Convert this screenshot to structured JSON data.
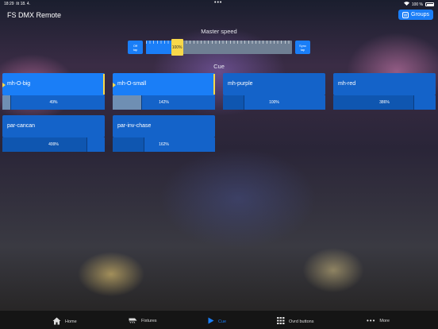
{
  "status": {
    "time": "18:29",
    "date": "št 18. 4.",
    "battery": "100 %"
  },
  "app": {
    "title": "FS DMX Remote",
    "groups_label": "Groups",
    "groups_icon": "groups-icon"
  },
  "master_speed": {
    "label": "Master speed",
    "off_label": "Off",
    "off_sub": "tap",
    "sync_label": "Sync",
    "sync_sub": "tap",
    "value": 100,
    "value_text": "100%",
    "position_fraction": 0.21
  },
  "cue_section": {
    "label": "Cue"
  },
  "cues": [
    {
      "name": "mh-O-big",
      "level_text": "49%",
      "level_fraction": 0.08,
      "playing": true
    },
    {
      "name": "mh-O-small",
      "level_text": "142%",
      "level_fraction": 0.28,
      "playing": true
    },
    {
      "name": "mh-purple",
      "level_text": "100%",
      "level_fraction": 0.2,
      "playing": false
    },
    {
      "name": "mh-red",
      "level_text": "386%",
      "level_fraction": 0.78,
      "playing": false
    },
    {
      "name": "par-cancan",
      "level_text": "499%",
      "level_fraction": 0.82,
      "playing": false
    },
    {
      "name": "par-inv-chase",
      "level_text": "162%",
      "level_fraction": 0.3,
      "playing": false
    }
  ],
  "colors": {
    "accent": "#1a7ef7",
    "cue_active": "#1a7ef7",
    "cue_idle": "#1463c9",
    "yellow": "#f8d84a"
  },
  "tabs": [
    {
      "label": "Home",
      "icon": "house-icon",
      "active": false
    },
    {
      "label": "Fixtures",
      "icon": "fixtures-icon",
      "active": false
    },
    {
      "label": "Cue",
      "icon": "play-icon",
      "active": true
    },
    {
      "label": "Ovrd buttons",
      "icon": "grid-icon",
      "active": false
    },
    {
      "label": "More",
      "icon": "more-dots-icon",
      "active": false
    }
  ]
}
